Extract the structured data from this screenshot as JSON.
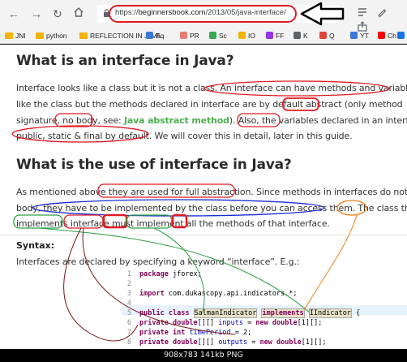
{
  "browser": {
    "url_prefix": "https://",
    "url_host": "beginnersbook.com",
    "url_path": "/2013/05/java-interface/",
    "bookmarks": [
      {
        "label": "JNI",
        "kind": "folder"
      },
      {
        "label": "python",
        "kind": "folder"
      },
      {
        "label": "REFLECTION IN JAVA",
        "kind": "folder"
      },
      {
        "label": "Eq",
        "kind": "site"
      },
      {
        "label": "PR",
        "kind": "site"
      },
      {
        "label": "Sc",
        "kind": "site"
      },
      {
        "label": "IO",
        "kind": "site"
      },
      {
        "label": "FF",
        "kind": "site"
      },
      {
        "label": "K",
        "kind": "site"
      },
      {
        "label": "Q",
        "kind": "site"
      },
      {
        "label": "YT",
        "kind": "site"
      },
      {
        "label": "Ch",
        "kind": "site"
      },
      {
        "label": "Q",
        "kind": "site"
      }
    ]
  },
  "article": {
    "h1": "What is an interface in Java?",
    "p1": [
      "Interface looks like a class but it is not a class. An interface can have methods and variables just",
      "like the class but the methods declared in interface are by default abstract (only method",
      "signature, no body, see: ",
      "). Also, the variables declared in an interface are",
      "public, static & final by default. We will cover this in detail, later in this guide."
    ],
    "p1_link": "Java abstract method",
    "h2": "What is the use of interface in Java?",
    "p2": [
      "As mentioned above they are used for full abstraction. Since methods in interfaces do not have",
      "body, they have to be implemented by the class before you can access them. The class that",
      "implements interface must implement all the methods of that interface."
    ],
    "syntax_label": "Syntax:",
    "p3": "Interfaces are declared by specifying a keyword “interface”. E.g.:"
  },
  "code": {
    "lines": [
      {
        "n": "1",
        "t": "package jforex;"
      },
      {
        "n": "2",
        "t": ""
      },
      {
        "n": "3",
        "t": "import com.dukascopy.api.indicators.*;"
      },
      {
        "n": "4",
        "t": ""
      },
      {
        "n": "5",
        "t": "public class SalmanIndicator implements IIndicator {"
      },
      {
        "n": "6",
        "t": "    private double[][] inputs = new double[1][];"
      },
      {
        "n": "7",
        "t": "    private int timePeriod = 2;"
      },
      {
        "n": "8",
        "t": "    private double[][] outputs = new double[1][];"
      }
    ]
  },
  "status": "908x783  141kb  PNG",
  "colors": {
    "red": "#e01b24",
    "blue": "#1a2bd6",
    "green": "#2ea043",
    "orange": "#f07f1a",
    "darkred": "#7a1515"
  }
}
